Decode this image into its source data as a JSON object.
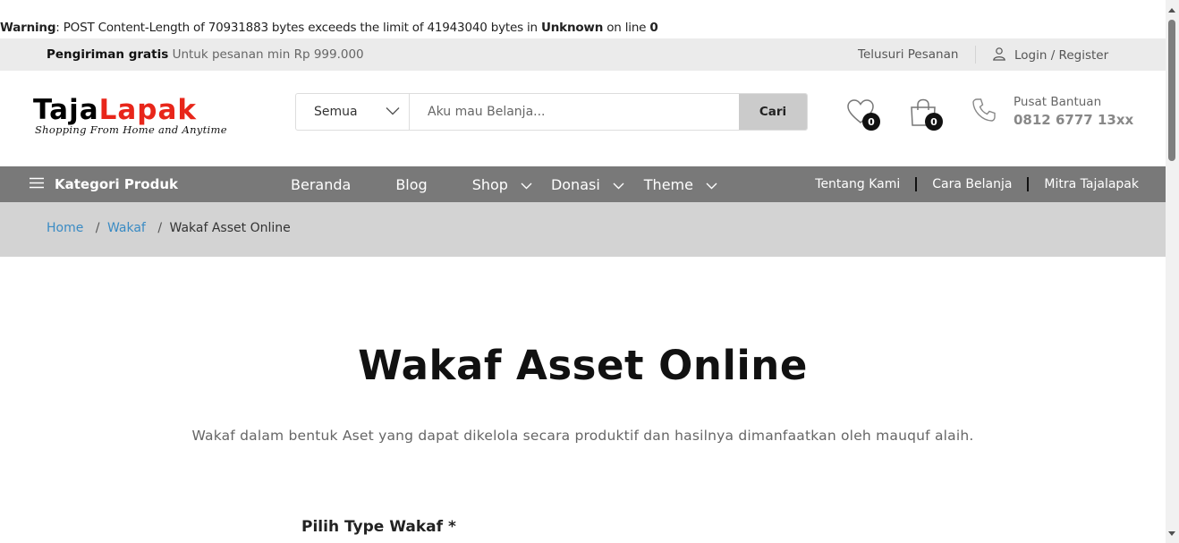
{
  "warning": {
    "prefix": "Warning",
    "message": ": POST Content-Length of 70931883 bytes exceeds the limit of 41943040 bytes in ",
    "file": "Unknown",
    "on_line": " on line ",
    "line": "0"
  },
  "topbar": {
    "shipping_bold": "Pengiriman gratis",
    "shipping_text": "Untuk pesanan min Rp 999.000",
    "track_order": "Telusuri Pesanan",
    "login_register": "Login / Register"
  },
  "logo": {
    "part1": "Taja",
    "part2": "Lapak",
    "tagline": "Shopping From Home and Anytime",
    "color_primary": "#000000",
    "color_accent": "#e8261a"
  },
  "search": {
    "category": "Semua",
    "placeholder": "Aku mau Belanja...",
    "button": "Cari"
  },
  "header_icons": {
    "wishlist_count": "0",
    "cart_count": "0"
  },
  "help": {
    "label": "Pusat Bantuan",
    "phone": "0812 6777 13xx"
  },
  "nav": {
    "category_menu": "Kategori Produk",
    "items": [
      {
        "label": "Beranda"
      },
      {
        "label": "Blog"
      },
      {
        "label": "Shop"
      },
      {
        "label": "Donasi"
      },
      {
        "label": "Theme"
      }
    ],
    "right": [
      "Tentang Kami",
      "Cara Belanja",
      "Mitra Tajalapak"
    ],
    "bg_color": "#797979"
  },
  "breadcrumb": {
    "home": "Home",
    "parent": "Wakaf",
    "current": "Wakaf Asset Online",
    "separator": "/"
  },
  "main": {
    "title": "Wakaf Asset Online",
    "description": "Wakaf dalam bentuk Aset yang dapat dikelola secara produktif dan hasilnya dimanfaatkan oleh mauquf alaih.",
    "field_label": "Pilih Type Wakaf *"
  }
}
